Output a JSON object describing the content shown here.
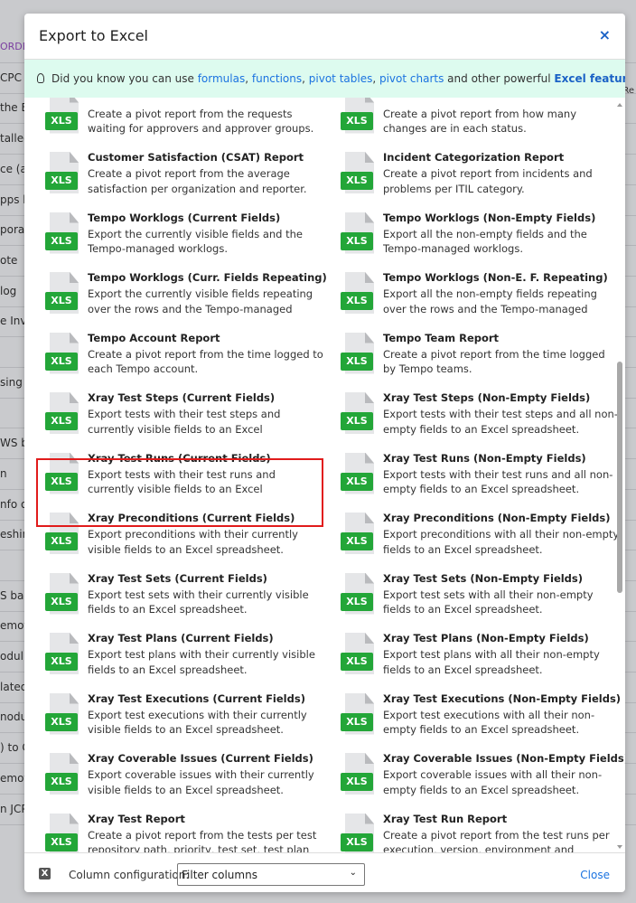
{
  "background": {
    "fragments": [
      "ORDE",
      "CPC",
      "the E",
      "talled",
      "ce (a",
      "pps b",
      "porari",
      "ote",
      "log",
      "e Inv",
      "",
      "sing c",
      "",
      "WS b",
      "n",
      "nfo or",
      "eshing",
      "",
      "S ba",
      "emote",
      "odul",
      "lated",
      "nodu",
      ") to C",
      "emot",
      "n JCP"
    ],
    "right_fragment": "Re"
  },
  "dialog": {
    "title": "Export to Excel",
    "close_icon": "×",
    "tip": {
      "prefix": "Did you know you can use ",
      "links": [
        "formulas",
        "functions",
        "pivot tables",
        "pivot charts"
      ],
      "middle": " and other powerful ",
      "strong_link": "Excel features",
      "suffix": "?"
    },
    "icon_label": "XLS",
    "rows": [
      [
        {
          "title": "",
          "desc": "Create a pivot report from the requests waiting for approvers and approver groups."
        },
        {
          "title": "",
          "desc": "Create a pivot report from how many changes are in each status."
        }
      ],
      [
        {
          "title": "Customer Satisfaction (CSAT) Report",
          "desc": "Create a pivot report from the average satisfaction per organization and reporter."
        },
        {
          "title": "Incident Categorization Report",
          "desc": "Create a pivot report from incidents and problems per ITIL category."
        }
      ],
      [
        {
          "title": "Tempo Worklogs (Current Fields)",
          "desc": "Export the currently visible fields and the Tempo-managed worklogs."
        },
        {
          "title": "Tempo Worklogs (Non-Empty Fields)",
          "desc": "Export all the non-empty fields and the Tempo-managed worklogs."
        }
      ],
      [
        {
          "title": "Tempo Worklogs (Curr. Fields Repeating)",
          "desc": "Export the currently visible fields repeating over the rows and the Tempo-managed worklogs."
        },
        {
          "title": "Tempo Worklogs (Non-E. F. Repeating)",
          "desc": "Export all the non-empty fields repeating over the rows and the Tempo-managed worklogs."
        }
      ],
      [
        {
          "title": "Tempo Account Report",
          "desc": "Create a pivot report from the time logged to each Tempo account."
        },
        {
          "title": "Tempo Team Report",
          "desc": "Create a pivot report from the time logged by Tempo teams."
        }
      ],
      [
        {
          "title": "Xray Test Steps (Current Fields)",
          "desc": "Export tests with their test steps and currently visible fields to an Excel spreadsheet."
        },
        {
          "title": "Xray Test Steps (Non-Empty Fields)",
          "desc": "Export tests with their test steps and all non-empty fields to an Excel spreadsheet."
        }
      ],
      [
        {
          "title": "Xray Test Runs (Current Fields)",
          "desc": "Export tests with their test runs and currently visible fields to an Excel spreadsheet."
        },
        {
          "title": "Xray Test Runs (Non-Empty Fields)",
          "desc": "Export tests with their test runs and all non-empty fields to an Excel spreadsheet."
        }
      ],
      [
        {
          "title": "Xray Preconditions (Current Fields)",
          "desc": "Export preconditions with their currently visible fields to an Excel spreadsheet."
        },
        {
          "title": "Xray Preconditions (Non-Empty Fields)",
          "desc": "Export preconditions with all their non-empty fields to an Excel spreadsheet."
        }
      ],
      [
        {
          "title": "Xray Test Sets (Current Fields)",
          "desc": "Export test sets with their currently visible fields to an Excel spreadsheet."
        },
        {
          "title": "Xray Test Sets (Non-Empty Fields)",
          "desc": "Export test sets with all their non-empty fields to an Excel spreadsheet."
        }
      ],
      [
        {
          "title": "Xray Test Plans (Current Fields)",
          "desc": "Export test plans with their currently visible fields to an Excel spreadsheet."
        },
        {
          "title": "Xray Test Plans (Non-Empty Fields)",
          "desc": "Export test plans with all their non-empty fields to an Excel spreadsheet."
        }
      ],
      [
        {
          "title": "Xray Test Executions (Current Fields)",
          "desc": "Export test executions with their currently visible fields to an Excel spreadsheet."
        },
        {
          "title": "Xray Test Executions (Non-Empty Fields)",
          "desc": "Export test executions with all their non-empty fields to an Excel spreadsheet."
        }
      ],
      [
        {
          "title": "Xray Coverable Issues (Current Fields)",
          "desc": "Export coverable issues with their currently visible fields to an Excel spreadsheet."
        },
        {
          "title": "Xray Coverable Issues (Non-Empty Fields)",
          "desc": "Export coverable issues with all their non-empty fields to an Excel spreadsheet."
        }
      ],
      [
        {
          "title": "Xray Test Report",
          "desc": "Create a pivot report from the tests per test repository path, priority, test set, test plan and"
        },
        {
          "title": "Xray Test Run Report",
          "desc": "Create a pivot report from the test runs per execution, version, environment and"
        }
      ]
    ],
    "footer": {
      "x_icon": "X",
      "column_config_label": "Column configuration:",
      "column_config_value": "Filter columns",
      "close_label": "Close"
    }
  }
}
